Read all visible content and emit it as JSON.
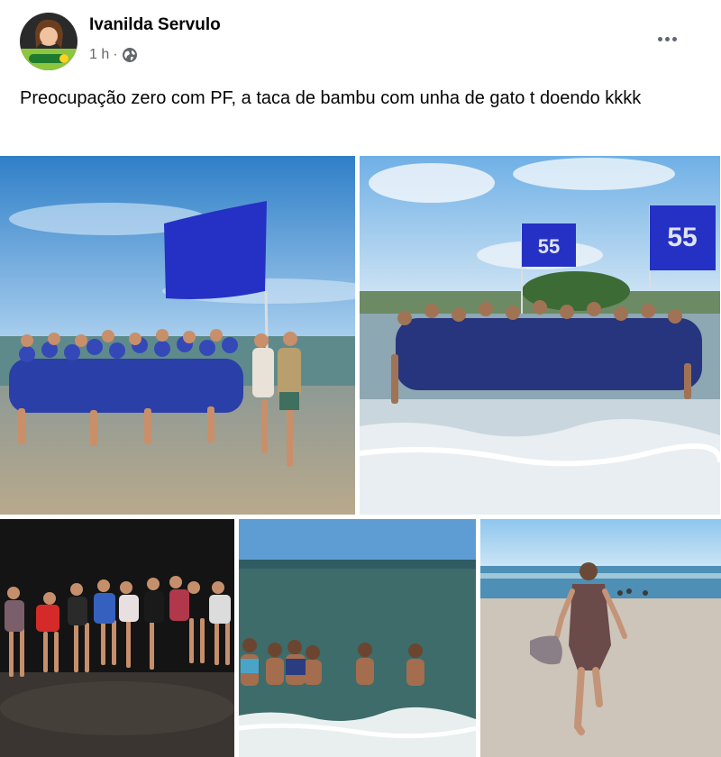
{
  "post": {
    "author_name": "Ivanilda Servulo",
    "time_label": "1 h",
    "separator": "·",
    "privacy_icon": "globe-icon",
    "more_icon": "more-options-icon",
    "text": "Preocupação zero com PF, a taca de bambu com unha de gato t doendo kkkk"
  },
  "photos": [
    {
      "flag_text": ""
    },
    {
      "flag_text_left": "55",
      "flag_text_right": "55"
    },
    {
      "flag_text": ""
    },
    {
      "flag_text": ""
    },
    {
      "flag_text": ""
    }
  ],
  "colors": {
    "name_text": "#050505",
    "meta_text": "#65676b",
    "flag_blue": "#2531c4",
    "sky_blue": "#4a9ad8",
    "sea_green": "#3e6e6a",
    "sand": "#c9b8a0"
  }
}
